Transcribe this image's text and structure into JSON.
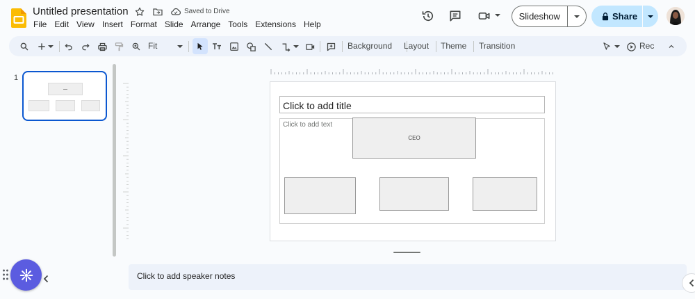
{
  "header": {
    "title": "Untitled presentation",
    "save_status": "Saved to Drive",
    "menu": [
      "File",
      "Edit",
      "View",
      "Insert",
      "Format",
      "Slide",
      "Arrange",
      "Tools",
      "Extensions",
      "Help"
    ],
    "slideshow_label": "Slideshow",
    "share_label": "Share"
  },
  "toolbar": {
    "zoom_label": "Fit",
    "background_label": "Background",
    "layout_label": "Layout",
    "theme_label": "Theme",
    "transition_label": "Transition",
    "rec_label": "Rec"
  },
  "filmstrip": {
    "slides": [
      {
        "number": "1"
      }
    ]
  },
  "slide": {
    "title_placeholder": "Click to add title",
    "body_placeholder": "Click to add text",
    "ceo_label": "CEO"
  },
  "notes": {
    "placeholder": "Click to add speaker notes"
  },
  "colors": {
    "accent": "#0b57d0",
    "share_bg": "#c2e7ff",
    "toolbar_bg": "#edf2fa",
    "app_logo": "#fbbc04",
    "assistant_fab": "#5b5ce0"
  },
  "icons": {
    "logo": "slides-logo-icon",
    "star": "star-icon",
    "move": "folder-move-icon",
    "cloud": "cloud-done-icon",
    "history": "history-icon",
    "comments": "comment-icon",
    "meet": "video-camera-icon",
    "lock": "lock-icon"
  }
}
